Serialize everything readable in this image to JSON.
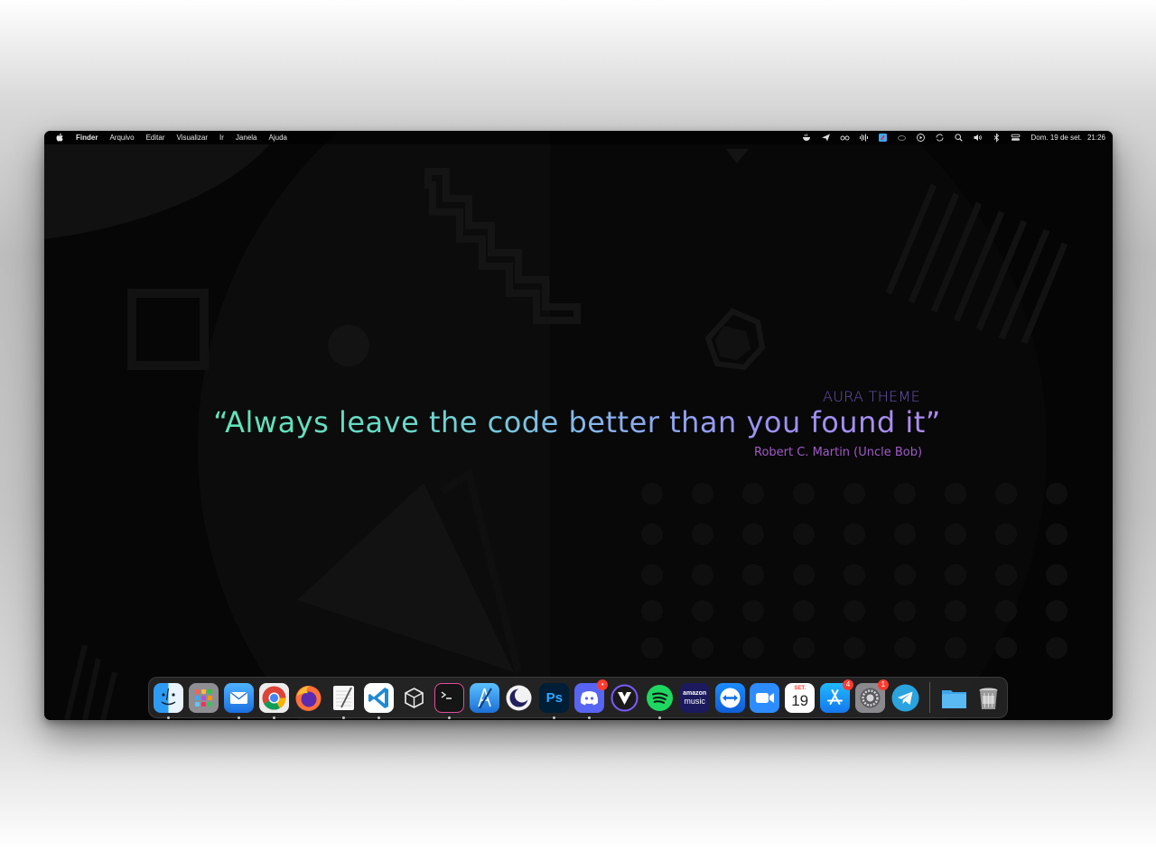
{
  "menubar": {
    "app_name": "Finder",
    "menus": [
      "Arquivo",
      "Editar",
      "Visualizar",
      "Ir",
      "Janela",
      "Ajuda"
    ],
    "status_icons": [
      "coffee-icon",
      "send-icon",
      "glasses-icon",
      "waveform-icon",
      "app-status-icon",
      "cloud-icon",
      "play-circle-icon",
      "sync-icon",
      "search-icon",
      "volume-icon",
      "bluetooth-icon",
      "control-center-icon"
    ],
    "date": "Dom. 19 de set.",
    "time": "21:26"
  },
  "wallpaper": {
    "theme_label": "AURA THEME",
    "quote": "“Always leave the code better than you found it”",
    "author": "Robert C. Martin (Uncle Bob)",
    "colors": {
      "gradient_start": "#5fe6b4",
      "gradient_end": "#b08cf0",
      "theme_label": "#6c55b8",
      "author": "#a05ac8"
    }
  },
  "dock": {
    "apps": [
      {
        "name": "Finder",
        "icon": "finder-icon",
        "running": true
      },
      {
        "name": "Launchpad",
        "icon": "launchpad-icon",
        "running": false
      },
      {
        "name": "Mail",
        "icon": "mail-icon",
        "running": true
      },
      {
        "name": "Google Chrome",
        "icon": "chrome-icon",
        "running": true
      },
      {
        "name": "Firefox",
        "icon": "firefox-icon",
        "running": false
      },
      {
        "name": "TextEdit",
        "icon": "textedit-icon",
        "running": true
      },
      {
        "name": "Visual Studio Code",
        "icon": "vscode-icon",
        "running": true
      },
      {
        "name": "VirtualBox",
        "icon": "box-icon",
        "running": false
      },
      {
        "name": "Terminal",
        "icon": "terminal-icon",
        "running": true
      },
      {
        "name": "Xcode",
        "icon": "xcode-icon",
        "running": false
      },
      {
        "name": "Lunar",
        "icon": "moon-icon",
        "running": false
      },
      {
        "name": "Photoshop",
        "icon": "photoshop-icon",
        "label": "Ps",
        "running": true
      },
      {
        "name": "Discord",
        "icon": "discord-icon",
        "badge": "•",
        "running": true
      },
      {
        "name": "Vectorize",
        "icon": "vectorize-icon",
        "running": false
      },
      {
        "name": "Spotify",
        "icon": "spotify-icon",
        "running": true
      },
      {
        "name": "Amazon Music",
        "icon": "amazon-music-icon",
        "label_top": "amazon",
        "label_bottom": "music",
        "running": false
      },
      {
        "name": "TeamViewer",
        "icon": "teamviewer-icon",
        "running": false
      },
      {
        "name": "Zoom",
        "icon": "zoom-icon",
        "running": false
      },
      {
        "name": "Calendar",
        "icon": "calendar-icon",
        "month": "SET.",
        "day": "19",
        "running": false
      },
      {
        "name": "App Store",
        "icon": "appstore-icon",
        "badge": "4",
        "running": false
      },
      {
        "name": "System Preferences",
        "icon": "settings-icon",
        "badge": "1",
        "running": false
      },
      {
        "name": "Telegram",
        "icon": "telegram-icon",
        "running": false
      }
    ],
    "stack": [
      {
        "name": "Downloads",
        "icon": "folder-icon"
      },
      {
        "name": "Trash",
        "icon": "trash-icon"
      }
    ]
  }
}
